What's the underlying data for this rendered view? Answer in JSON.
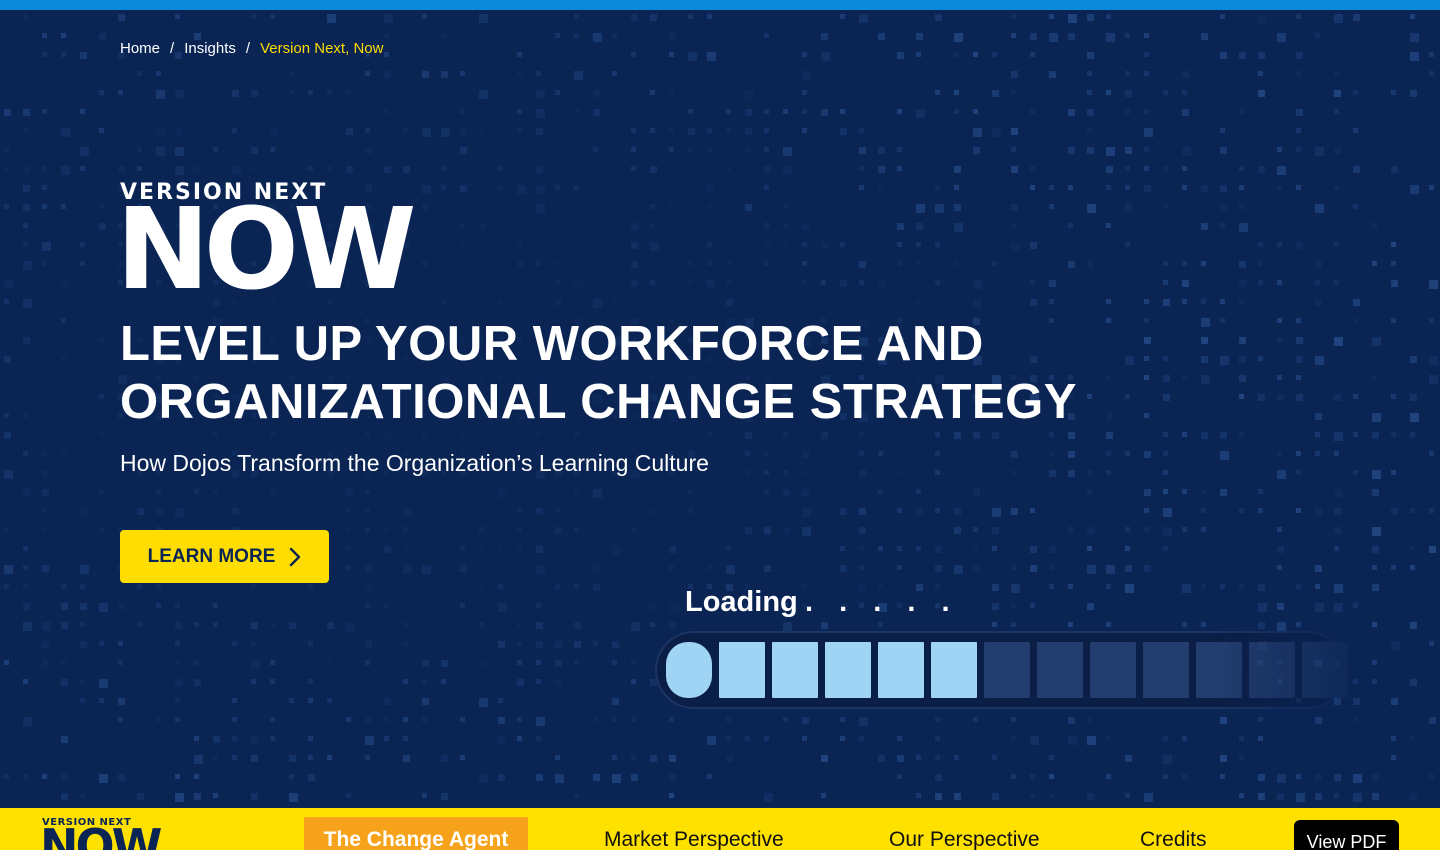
{
  "breadcrumb": {
    "items": [
      "Home",
      "Insights"
    ],
    "separator": "/",
    "current": "Version Next, Now"
  },
  "hero": {
    "logo_small": "VERSION NEXT",
    "logo_big": "NOW",
    "headline": "LEVEL UP YOUR WORKFORCE AND ORGANIZATIONAL CHANGE STRATEGY",
    "subhead": "How Dojos Transform the Organization’s Learning Culture",
    "cta_label": "LEARN MORE",
    "cta_icon": "chevron-right-icon"
  },
  "loader": {
    "label": "Loading",
    "dots": ". . . . .",
    "filled_segments": 6,
    "total_segments": 13
  },
  "nav": {
    "logo_small": "VERSION NEXT",
    "logo_big": "NOW",
    "items": [
      "The Change Agent",
      "Market Perspective",
      "Our Perspective",
      "Credits"
    ],
    "active_index": 0,
    "pdf_label": "View PDF"
  },
  "colors": {
    "navy": "#0a2454",
    "yellow": "#ffdd00",
    "orange": "#f7a21b",
    "top_strip": "#0a8ad8",
    "loader_fill": "#9fd4f5"
  }
}
